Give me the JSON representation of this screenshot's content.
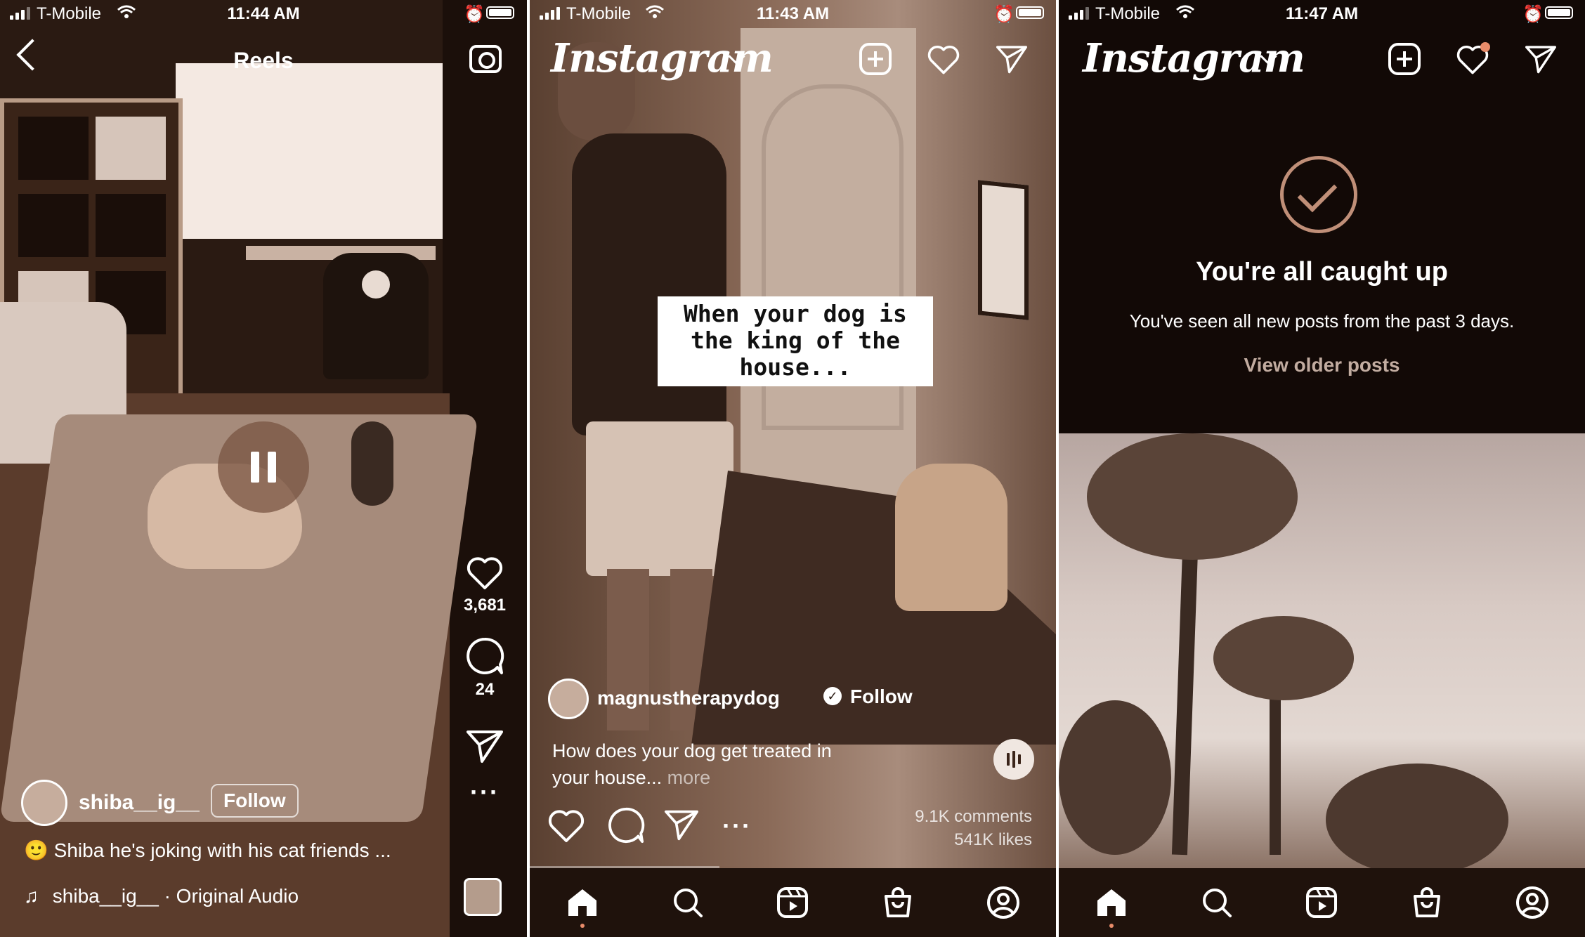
{
  "screens": [
    {
      "status": {
        "carrier": "T-Mobile",
        "time": "11:44 AM"
      },
      "header": {
        "title": "Reels"
      },
      "actions": {
        "likes": "3,681",
        "comments": "24"
      },
      "reel": {
        "username": "shiba__ig__",
        "follow_label": "Follow",
        "caption": "Shiba he's joking with his cat friends ...",
        "audio": "shiba__ig__ · Original Audio"
      },
      "icons": [
        "back-icon",
        "camera-icon",
        "pause-icon",
        "heart-icon",
        "comment-icon",
        "send-icon",
        "more-icon",
        "music-note-icon"
      ]
    },
    {
      "status": {
        "carrier": "T-Mobile",
        "time": "11:43 AM"
      },
      "header": {
        "logo": "Instagram"
      },
      "video_caption": "When your dog is the king of the house...",
      "post": {
        "author": "magnustherapydog",
        "follow_label": "Follow",
        "text": "How does your dog get treated in your house...",
        "more": "more",
        "comments": "9.1K comments",
        "likes": "541K likes"
      },
      "icons": [
        "new-post-icon",
        "heart-icon",
        "send-icon",
        "verified-icon",
        "audio-icon",
        "comment-icon",
        "more-icon",
        "home-icon",
        "search-icon",
        "reels-icon",
        "shop-icon",
        "profile-icon"
      ]
    },
    {
      "status": {
        "carrier": "T-Mobile",
        "time": "11:47 AM"
      },
      "header": {
        "logo": "Instagram"
      },
      "caught_up": {
        "title": "You're all caught up",
        "subtitle": "You've seen all new posts from the past 3 days.",
        "older_link": "View older posts"
      },
      "icons": [
        "new-post-icon",
        "heart-icon",
        "send-icon",
        "check-icon",
        "home-icon",
        "search-icon",
        "reels-icon",
        "shop-icon",
        "profile-icon"
      ]
    }
  ],
  "colors": {
    "accent": "#c08f78",
    "activity_dot": "#e88c6a",
    "tabbar": "#1f120c"
  }
}
